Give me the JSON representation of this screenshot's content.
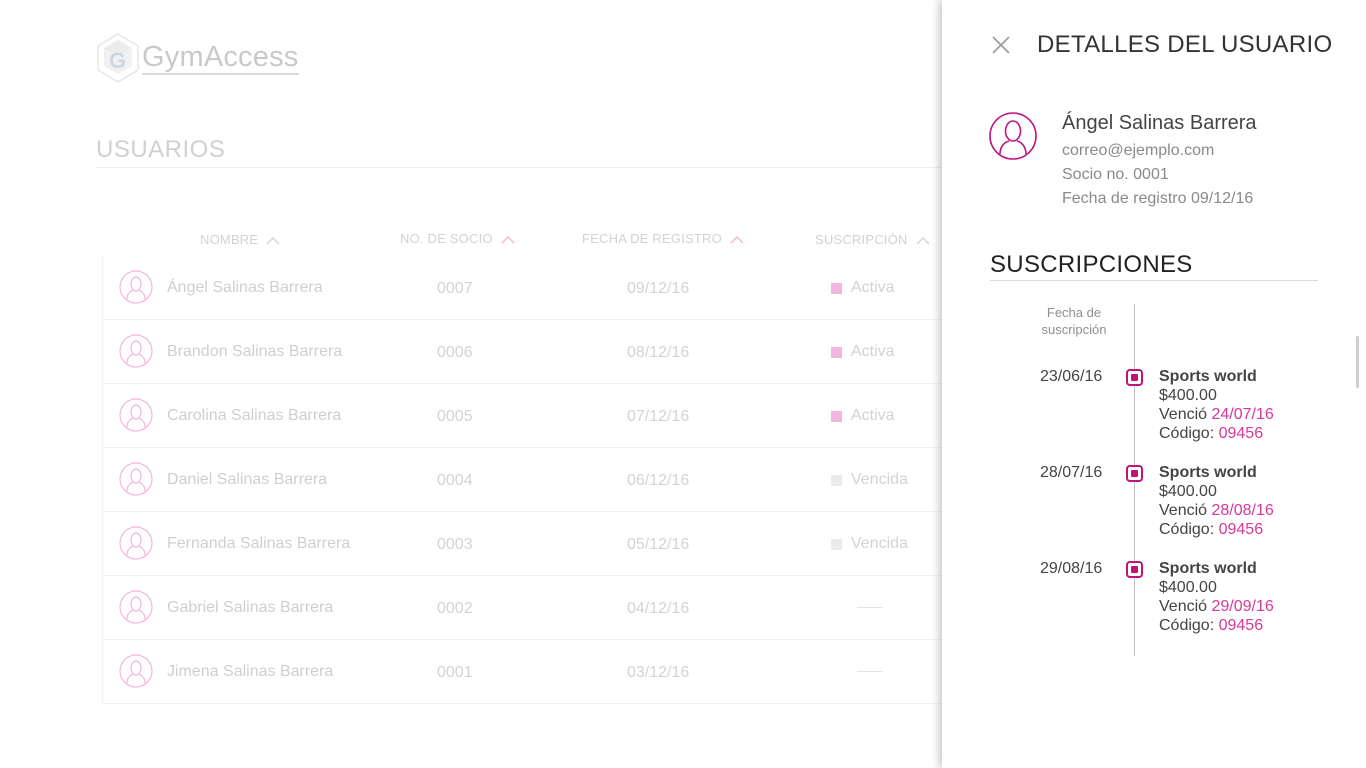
{
  "app": {
    "logo_text": "GymAccess"
  },
  "page": {
    "title": "USUARIOS"
  },
  "columns": [
    {
      "label": "NOMBRE"
    },
    {
      "label": "NO. DE SOCIO"
    },
    {
      "label": "FECHA DE REGISTRO"
    },
    {
      "label": "SUSCRIPCIÓN"
    }
  ],
  "users": [
    {
      "name": "Ángel Salinas Barrera",
      "no": "0007",
      "date": "09/12/16",
      "status": "Activa",
      "status_color": "#f2b7de"
    },
    {
      "name": "Brandon Salinas Barrera",
      "no": "0006",
      "date": "08/12/16",
      "status": "Activa",
      "status_color": "#f2b7de"
    },
    {
      "name": "Carolina Salinas Barrera",
      "no": "0005",
      "date": "07/12/16",
      "status": "Activa",
      "status_color": "#f2b7de"
    },
    {
      "name": "Daniel Salinas Barrera",
      "no": "0004",
      "date": "06/12/16",
      "status": "Vencida",
      "status_color": "#ebebeb"
    },
    {
      "name": "Fernanda Salinas Barrera",
      "no": "0003",
      "date": "05/12/16",
      "status": "Vencida",
      "status_color": "#ebebeb"
    },
    {
      "name": "Gabriel Salinas Barrera",
      "no": "0002",
      "date": "04/12/16",
      "status": "",
      "status_color": ""
    },
    {
      "name": "Jimena Salinas Barrera",
      "no": "0001",
      "date": "03/12/16",
      "status": "",
      "status_color": ""
    }
  ],
  "drawer": {
    "title": "DETALLES DEL USUARIO",
    "close_icon": "close-icon",
    "profile": {
      "name": "Ángel Salinas Barrera",
      "email": "correo@ejemplo.com",
      "socio": "Socio no. 0001",
      "registro": "Fecha de registro 09/12/16"
    },
    "subs_title": "SUSCRIPCIONES",
    "timeline_header": "Fecha de suscripción",
    "timeline_header_l1": "Fecha de",
    "timeline_header_l2": "suscripción",
    "subscriptions": [
      {
        "date": "23/06/16",
        "gym": "Sports world",
        "price": "$400.00",
        "vencio_label": "Venció",
        "vencio": "24/07/16",
        "codigo_label": "Código:",
        "codigo": "09456"
      },
      {
        "date": "28/07/16",
        "gym": "Sports world",
        "price": "$400.00",
        "vencio_label": "Venció",
        "vencio": "28/08/16",
        "codigo_label": "Código:",
        "codigo": "09456"
      },
      {
        "date": "29/08/16",
        "gym": "Sports world",
        "price": "$400.00",
        "vencio_label": "Venció",
        "vencio": "29/09/16",
        "codigo_label": "Código:",
        "codigo": "09456"
      }
    ]
  },
  "colors": {
    "accent": "#c0137f",
    "accent_text": "#d8379c",
    "faded_accent": "#f2b7de"
  }
}
